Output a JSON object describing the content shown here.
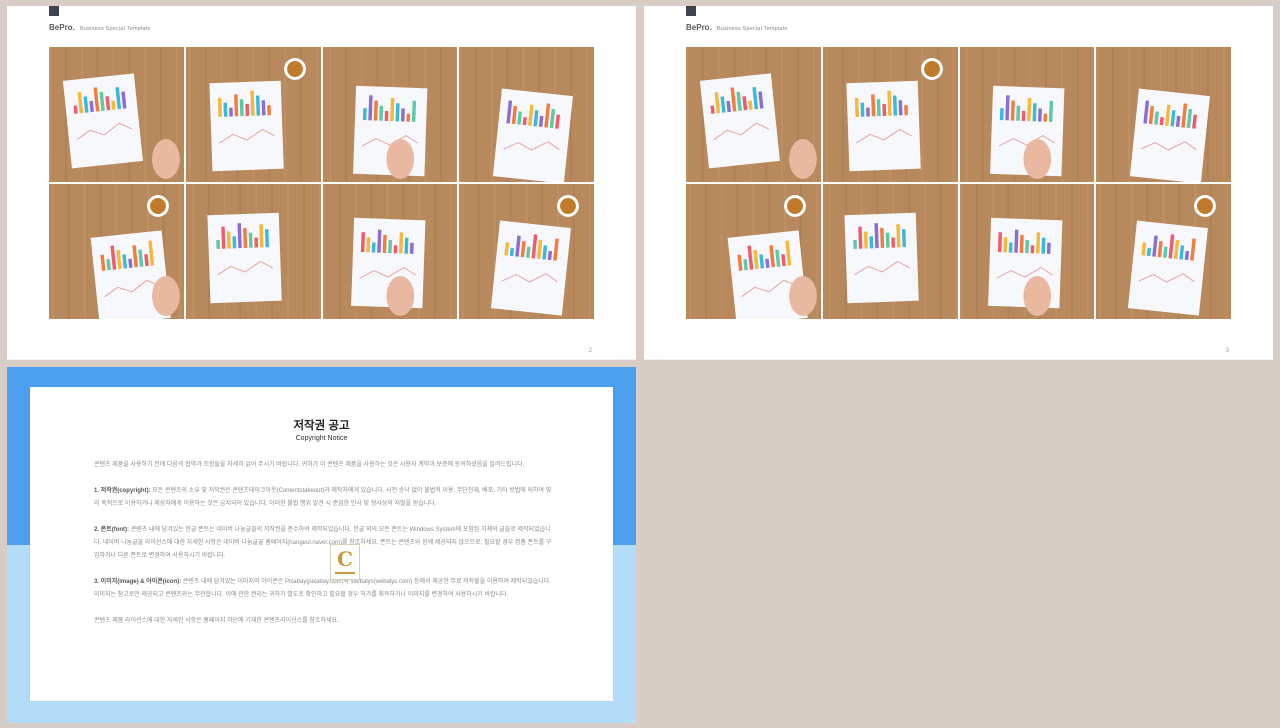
{
  "slides": [
    {
      "brand": "BePro.",
      "tagline": "Business  Special  Template",
      "page_number": "2"
    },
    {
      "brand": "BePro.",
      "tagline": "Business  Special  Template",
      "page_number": "3"
    }
  ],
  "notice": {
    "title": "저작권 공고",
    "subtitle": "Copyright Notice",
    "intro": "콘텐츠 제품을 사용하기 전에 다음의 협약과 조항들을 자세히 읽어 주시기 바랍니다. 귀하가 이 콘텐츠 제품을 사용하는 것은 사용자 계약과 보증에 동의하셨음을 알려드립니다.",
    "section1_heading": "1. 저작권(copyright):",
    "section1_text": " 모든 콘텐츠의 소유 및 저작권은 콘텐츠테이크아웃(Contentstakeout)과 제작자에게 있습니다. 사전 승낙 없이 불법적 이용, 무단전재, 배포, 기타 방법에 의하여 영리 목적으로 이용하거나 제삼자에게 이용하는 것은 금지되어 있습니다. 이러한 불법 행위 발견 시 준엄한 민사 및 형사상의 처벌을 받습니다.",
    "section2_heading": "2. 폰트(font):",
    "section2_text": " 콘텐츠 내에 담겨있는 한글 폰트는 네이버 나눔글꼴의 저작권을 준수하여 제작되었습니다. 한글 외의 모든 폰트는 Windows System에 포함된 자체의 글꼴로 제작되었습니다. 네이버 나눔글꼴 라이선스에 대한 자세한 사항은 네이버 나눔글꼴 홈페이지(hangeul.naver.com)를 참조하세요. 폰트는 콘텐츠와 함께 제공되지 않으므로, 필요할 경우 정품 폰트를 구입하거나 다른 폰트로 변경하여 사용하시기 바랍니다.",
    "section3_heading": "3. 이미지(image) & 아이콘(icon):",
    "section3_text": " 콘텐츠 내에 담겨있는 이미지와 아이콘은 Pixabay(pixabay.com)와 Webalys(webalys.com) 등에서 제공한 무료 저작물을 이용하여 제작되었습니다. 이미지는 참고로만 제공되고 콘텐츠와는 무관합니다. 이에 관한 권리는 귀하가 별도로 확인하고 필요할 경우 허가를 취득하거나 이미지를 변경하여 사용하시기 바랍니다.",
    "footer": "콘텐츠 제품 라이선스에 대한 자세한 사항은 홈페이지 하단에 기재한 콘텐츠라이선스를 참조하세요.",
    "badge_letter": "C"
  },
  "colors": {
    "accent_blue": "#4c9fef",
    "light_blue": "#b3dcf8",
    "desk_wood": "#b7875a",
    "badge_gold": "#c89b3c"
  }
}
